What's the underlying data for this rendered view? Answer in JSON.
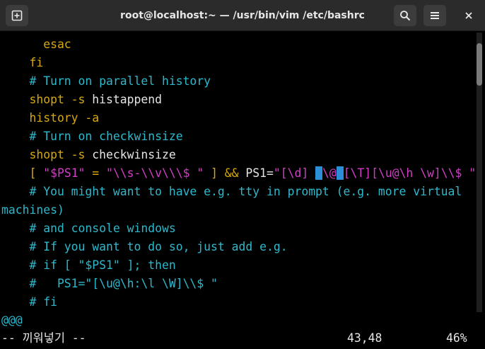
{
  "window": {
    "title": "root@localhost:~ — /usr/bin/vim /etc/bashrc",
    "new_tab_icon": "new-tab-icon",
    "search_icon": "search-icon",
    "menu_icon": "hamburger-menu-icon",
    "close_icon": "close-icon"
  },
  "editor": {
    "lines": [
      [
        {
          "t": "      esac",
          "c": "kw"
        }
      ],
      [
        {
          "t": "    fi",
          "c": "kw"
        }
      ],
      [
        {
          "t": "    # Turn on parallel history",
          "c": "cm"
        }
      ],
      [
        {
          "t": "    shopt -s ",
          "c": "kw"
        },
        {
          "t": "histappend",
          "c": "pl"
        }
      ],
      [
        {
          "t": "    history -a",
          "c": "kw"
        }
      ],
      [
        {
          "t": "    # Turn on checkwinsize",
          "c": "cm"
        }
      ],
      [
        {
          "t": "    shopt -s ",
          "c": "kw"
        },
        {
          "t": "checkwinsize",
          "c": "pl"
        }
      ],
      [
        {
          "t": "    [ ",
          "c": "kw"
        },
        {
          "t": "\"$PS1\"",
          "c": "st"
        },
        {
          "t": " = ",
          "c": "kw"
        },
        {
          "t": "\"\\\\s-\\\\v\\\\\\$ \"",
          "c": "st"
        },
        {
          "t": " ] && ",
          "c": "kw"
        },
        {
          "t": "PS1=",
          "c": "pl"
        },
        {
          "t": "\"[\\d] ",
          "c": "st"
        },
        {
          "t": " ",
          "c": "cur"
        },
        {
          "t": "\\@",
          "c": "st"
        },
        {
          "t": " ",
          "c": "cur"
        },
        {
          "t": "[\\T][\\u@\\h \\w]\\\\$ \"",
          "c": "st"
        }
      ],
      [
        {
          "t": "    # You might want to have e.g. tty in prompt (e.g. more virtual",
          "c": "cm"
        }
      ],
      [
        {
          "t": "machines)",
          "c": "cm"
        }
      ],
      [
        {
          "t": "    # and console windows",
          "c": "cm"
        }
      ],
      [
        {
          "t": "    # If you want to do so, just add e.g.",
          "c": "cm"
        }
      ],
      [
        {
          "t": "    # if [ \"$PS1\" ]; then",
          "c": "cm"
        }
      ],
      [
        {
          "t": "    #   PS1=\"[\\u@\\h:\\l \\W]\\\\$ \"",
          "c": "cm"
        }
      ],
      [
        {
          "t": "    # fi",
          "c": "cm"
        }
      ],
      [
        {
          "t": "@@@",
          "c": "cm"
        }
      ]
    ]
  },
  "statusline": {
    "mode": "-- 끼워넣기 --",
    "position": "43,48",
    "percent": "46%"
  },
  "scrollbar": {
    "position_fraction": 0.46
  }
}
